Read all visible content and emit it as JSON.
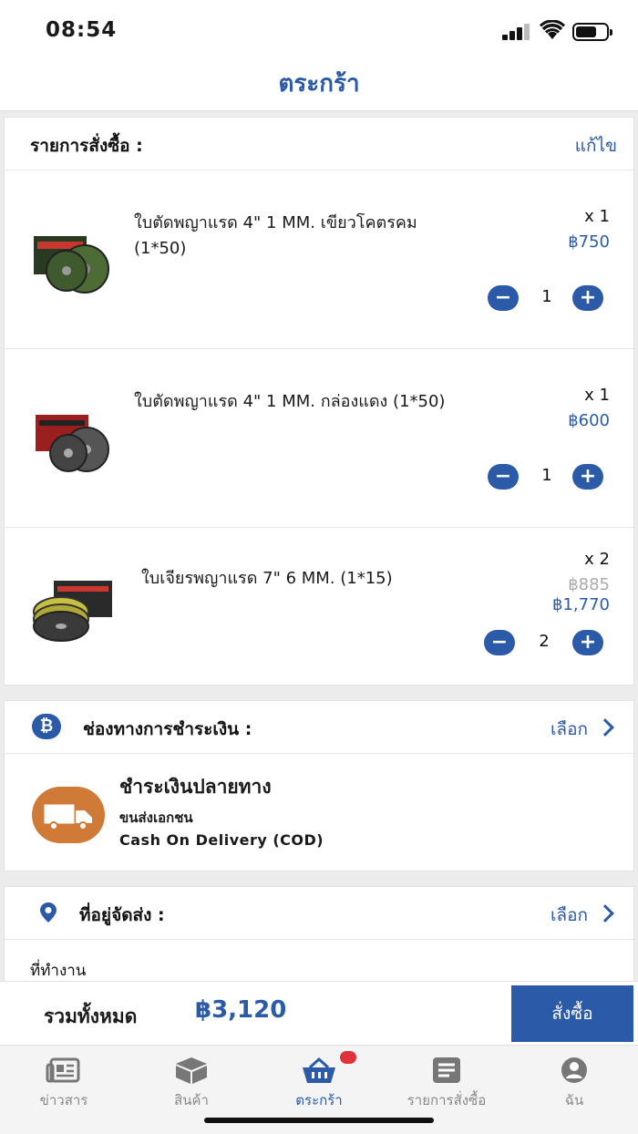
{
  "status": {
    "time": "08:54"
  },
  "header": {
    "title": "ตระกร้า"
  },
  "order": {
    "label": "รายการสั่งซื้อ :",
    "edit_label": "แก้ไข",
    "items": [
      {
        "name": "ใบตัดพญาแรด 4\" 1 MM. เขียวโคตรคม (1*50)",
        "qty_label": "x 1",
        "price": "฿750",
        "qty": "1",
        "thumb_color": "#3c5a2e"
      },
      {
        "name": "ใบตัดพญาแรด 4\" 1 MM. กล่องแดง (1*50)",
        "qty_label": "x 1",
        "price": "฿600",
        "qty": "1",
        "thumb_color": "#8a1f1f"
      },
      {
        "name": "ใบเจียรพญาแรด 7\" 6 MM. (1*15)",
        "qty_label": "x 2",
        "old_price": "฿885",
        "price": "฿1,770",
        "qty": "2",
        "thumb_color": "#b8b03a"
      }
    ]
  },
  "payment": {
    "label": "ช่องทางการชำระเงิน :",
    "select_label": "เลือก",
    "method_title": "ชำระเงินปลายทาง",
    "method_sub": "ขนส่งเอกชน",
    "method_cod": "Cash On Delivery (COD)",
    "icon": "bitcoin-icon"
  },
  "address": {
    "label": "ที่อยู่จัดส่ง :",
    "select_label": "เลือก",
    "line1": "ที่ทำงาน"
  },
  "total": {
    "label": "รวมทั้งหมด",
    "value": "฿3,120",
    "order_button": "สั่งซื้อ"
  },
  "tabs": [
    {
      "label": "ข่าวสาร",
      "icon": "newspaper-icon"
    },
    {
      "label": "สินค้า",
      "icon": "box-icon"
    },
    {
      "label": "ตระกร้า",
      "icon": "basket-icon",
      "active": true
    },
    {
      "label": "รายการสั่งซื้อ",
      "icon": "list-icon"
    },
    {
      "label": "ฉัน",
      "icon": "user-icon"
    }
  ],
  "colors": {
    "accent": "#2b5aa8",
    "badge": "#e0323a",
    "truck": "#cf7a36"
  }
}
